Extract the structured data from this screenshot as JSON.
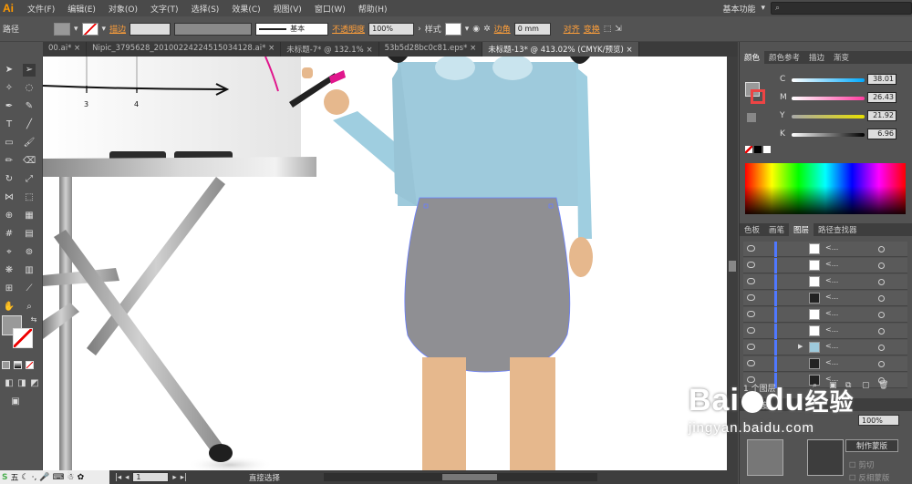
{
  "menu": {
    "logo": "Ai",
    "items": [
      "文件(F)",
      "编辑(E)",
      "对象(O)",
      "文字(T)",
      "选择(S)",
      "效果(C)",
      "视图(V)",
      "窗口(W)",
      "帮助(H)"
    ],
    "workspace": "基本功能"
  },
  "control": {
    "mode": "路径",
    "stroke_label": "描边",
    "stroke_style": "基本",
    "opacity_label": "不透明度",
    "opacity_value": "100%",
    "style_label": "样式",
    "corner_label": "边角",
    "corner_value": "0 mm",
    "align_label": "对齐",
    "transform_label": "变换"
  },
  "tabs": [
    "00.ai*",
    "Nipic_3795628_20100224224515034128.ai*",
    "未标题-7* @ 132.1%",
    "53b5d28bc0c81.eps*",
    "未标题-13* @ 413.02% (CMYK/预览)"
  ],
  "tab_close": "×",
  "panel": {
    "color_tabs": [
      "颜色",
      "颜色参考",
      "描边",
      "渐变"
    ],
    "channels": [
      {
        "name": "C",
        "value": "38.01",
        "color": "#00aaff"
      },
      {
        "name": "M",
        "value": "26.43",
        "color": "#ff3ca0"
      },
      {
        "name": "Y",
        "value": "21.92",
        "color": "#e7e000"
      },
      {
        "name": "K",
        "value": "6.96",
        "color": "#777777"
      }
    ],
    "layer_tabs": [
      "色板",
      "画笔",
      "图层",
      "路径查找器"
    ],
    "layer_names": [
      "<...",
      "<...",
      "<...",
      "<...",
      "<...",
      "<...",
      "<...",
      "<...",
      "<..."
    ],
    "layers_count": "1 个图层",
    "transparency_label": "透明度",
    "transparency_value": "100%",
    "make_mask": "制作蒙版",
    "clip_label": "剪切",
    "invert_label": "反相蒙版"
  },
  "status": {
    "zoom_page": "1",
    "tool_name": "直接选择"
  },
  "taskbar": {
    "ime": "五"
  },
  "watermark": {
    "brand": "Bai",
    "brand2": "du",
    "brand3": "经验",
    "url": "jingyan.baidu.com"
  }
}
